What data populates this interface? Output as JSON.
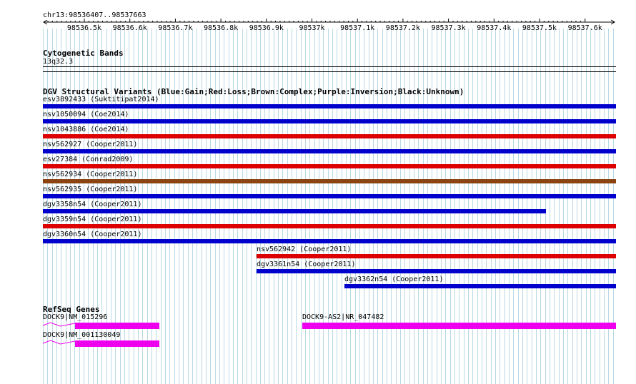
{
  "locus": "chr13:98536407..98537663",
  "ruler_ticks": [
    "98536.5k",
    "98536.6k",
    "98536.7k",
    "98536.8k",
    "98536.9k",
    "98537k",
    "98537.1k",
    "98537.2k",
    "98537.3k",
    "98537.4k",
    "98537.5k",
    "98537.6k"
  ],
  "cyto": {
    "title": "Cytogenetic Bands",
    "band": "13q32.3"
  },
  "dgv": {
    "title": "DGV Structural Variants (Blue:Gain;Red:Loss;Brown:Complex;Purple:Inversion;Black:Unknown)",
    "colors": {
      "gain": "#0000cc",
      "loss": "#dd0000",
      "complex": "#8b4513"
    },
    "variants": [
      {
        "label": "esv3892433 (Suktitipat2014)",
        "type": "gain"
      },
      {
        "label": "nsv1050094 (Coe2014)",
        "type": "gain"
      },
      {
        "label": "nsv1043886 (Coe2014)",
        "type": "loss"
      },
      {
        "label": "nsv562927 (Cooper2011)",
        "type": "gain"
      },
      {
        "label": "esv27384 (Conrad2009)",
        "type": "loss"
      },
      {
        "label": "nsv562934 (Cooper2011)",
        "type": "complex"
      },
      {
        "label": "nsv562935 (Cooper2011)",
        "type": "gain"
      },
      {
        "label": "dgv3358n54 (Cooper2011)",
        "type": "gain"
      },
      {
        "label": "dgv3359n54 (Cooper2011)",
        "type": "loss"
      },
      {
        "label": "dgv3360n54 (Cooper2011)",
        "type": "gain"
      },
      {
        "label": "nsv562942 (Cooper2011)",
        "type": "loss"
      },
      {
        "label": "dgv3361n54 (Cooper2011)",
        "type": "gain"
      },
      {
        "label": "dgv3362n54 (Cooper2011)",
        "type": "gain"
      }
    ]
  },
  "refseq": {
    "title": "RefSeq Genes",
    "color": "#ee00ee",
    "genes": [
      {
        "label": "DOCK9|NM_015296"
      },
      {
        "label": "DOCK9|NM_001130049"
      },
      {
        "label": "DOCK9-AS2|NR_047482"
      }
    ]
  }
}
